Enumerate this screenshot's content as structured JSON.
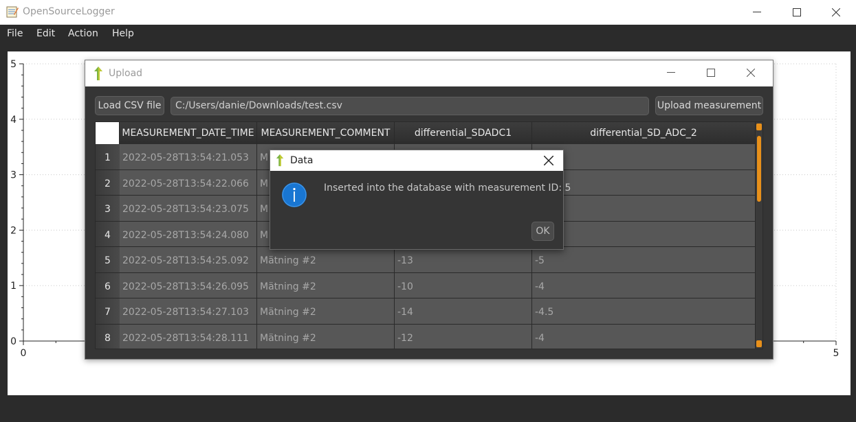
{
  "app": {
    "title": "OpenSourceLogger",
    "window_controls": [
      "minimize-icon",
      "maximize-icon",
      "close-icon"
    ]
  },
  "menu": [
    "File",
    "Edit",
    "Action",
    "Help"
  ],
  "chart_data": {
    "type": "line",
    "title": "",
    "xlabel": "",
    "ylabel": "",
    "xlim": [
      0,
      5
    ],
    "ylim": [
      0,
      5
    ],
    "x_ticks": [
      "0",
      "5"
    ],
    "y_ticks": [
      "0",
      "1",
      "2",
      "3",
      "4",
      "5"
    ],
    "grid": true,
    "series": []
  },
  "upload": {
    "title": "Upload",
    "load_button": "Load CSV file",
    "path_value": "C:/Users/danie/Downloads/test.csv",
    "upload_button": "Upload measurement",
    "table": {
      "columns": [
        "MEASUREMENT_DATE_TIME",
        "MEASUREMENT_COMMENT",
        "differential_SDADC1",
        "differential_SD_ADC_2"
      ],
      "rows": [
        {
          "num": "1",
          "cells": [
            "2022-05-28T13:54:21.053",
            "M",
            "",
            ""
          ]
        },
        {
          "num": "2",
          "cells": [
            "2022-05-28T13:54:22.066",
            "M",
            "",
            ""
          ]
        },
        {
          "num": "3",
          "cells": [
            "2022-05-28T13:54:23.075",
            "M",
            "",
            ""
          ]
        },
        {
          "num": "4",
          "cells": [
            "2022-05-28T13:54:24.080",
            "M",
            "",
            ""
          ]
        },
        {
          "num": "5",
          "cells": [
            "2022-05-28T13:54:25.092",
            "Mätning #2",
            "-13",
            "-5"
          ]
        },
        {
          "num": "6",
          "cells": [
            "2022-05-28T13:54:26.095",
            "Mätning #2",
            "-10",
            "-4"
          ]
        },
        {
          "num": "7",
          "cells": [
            "2022-05-28T13:54:27.103",
            "Mätning #2",
            "-14",
            "-4.5"
          ]
        },
        {
          "num": "8",
          "cells": [
            "2022-05-28T13:54:28.111",
            "Mätning #2",
            "-12",
            "-4"
          ]
        }
      ]
    }
  },
  "dialog": {
    "title": "Data",
    "message": "Inserted into the database with measurement ID: 5",
    "ok_button": "OK",
    "icon": "info-icon",
    "close_icon": "close-icon"
  },
  "colors": {
    "accent": "#e8901a",
    "info_blue": "#1976d2",
    "upload_arrow": "#7cb342"
  }
}
